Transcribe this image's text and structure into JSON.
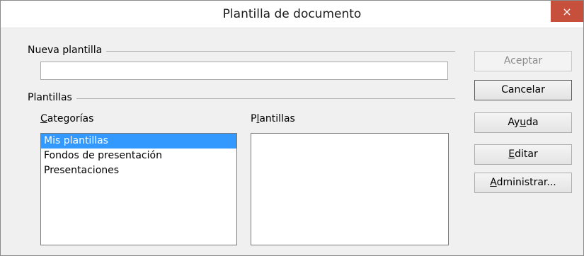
{
  "window": {
    "title": "Plantilla de documento"
  },
  "close_icon": "×",
  "nueva_plantilla": {
    "label": "Nueva plantilla",
    "value": ""
  },
  "plantillas_section": {
    "label": "Plantillas"
  },
  "categorias": {
    "label_mnemonic": "C",
    "label_rest": "ategorías",
    "items": [
      "Mis plantillas",
      "Fondos de presentación",
      "Presentaciones"
    ],
    "selected": "Mis plantillas"
  },
  "plantillas_list": {
    "label_first": "P",
    "label_mnemonic": "l",
    "label_rest": "antillas",
    "items": []
  },
  "buttons": {
    "aceptar": "Aceptar",
    "cancelar": "Cancelar",
    "ayuda_a": "Ay",
    "ayuda_u": "u",
    "ayuda_b": "da",
    "editar_u": "E",
    "editar_b": "ditar",
    "administrar_u": "A",
    "administrar_b": "dministrar..."
  },
  "colors": {
    "selection": "#3399ff",
    "close_button": "#c7503c"
  }
}
